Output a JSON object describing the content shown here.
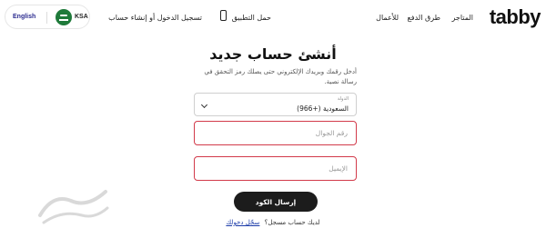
{
  "nav": {
    "logo": "tabby",
    "stores": "المتاجر",
    "payment_methods": "طرق الدفع",
    "for_business": "للأعمال",
    "get_app": "حمل التطبيق",
    "login_signup": "تسجيل الدخول أو إنشاء حساب",
    "language": "English",
    "country": "KSA"
  },
  "form": {
    "title": "أنشئ حساب جديد",
    "subtitle": "أدخل رقمك وبريدك الإلكتروني حتى يصلك رمز التحقق في رسالة نصية.",
    "country_label": "الدولة",
    "country_value": "السعودية (+966)",
    "phone_placeholder": "رقم الجوال",
    "email_placeholder": "الإيميل",
    "submit_label": "إرسال الكود",
    "have_account": "لديك حساب مسجل؟",
    "login_link": "سجّل دخولك"
  },
  "colors": {
    "error_border": "#d23a4a",
    "button_bg": "#1c1c1c",
    "link": "#1a3aa8",
    "flag_green": "#1f7a3a"
  },
  "icons": {
    "phone": "phone-icon",
    "flag": "saudi-flag-icon",
    "chevron": "chevron-down-icon"
  }
}
